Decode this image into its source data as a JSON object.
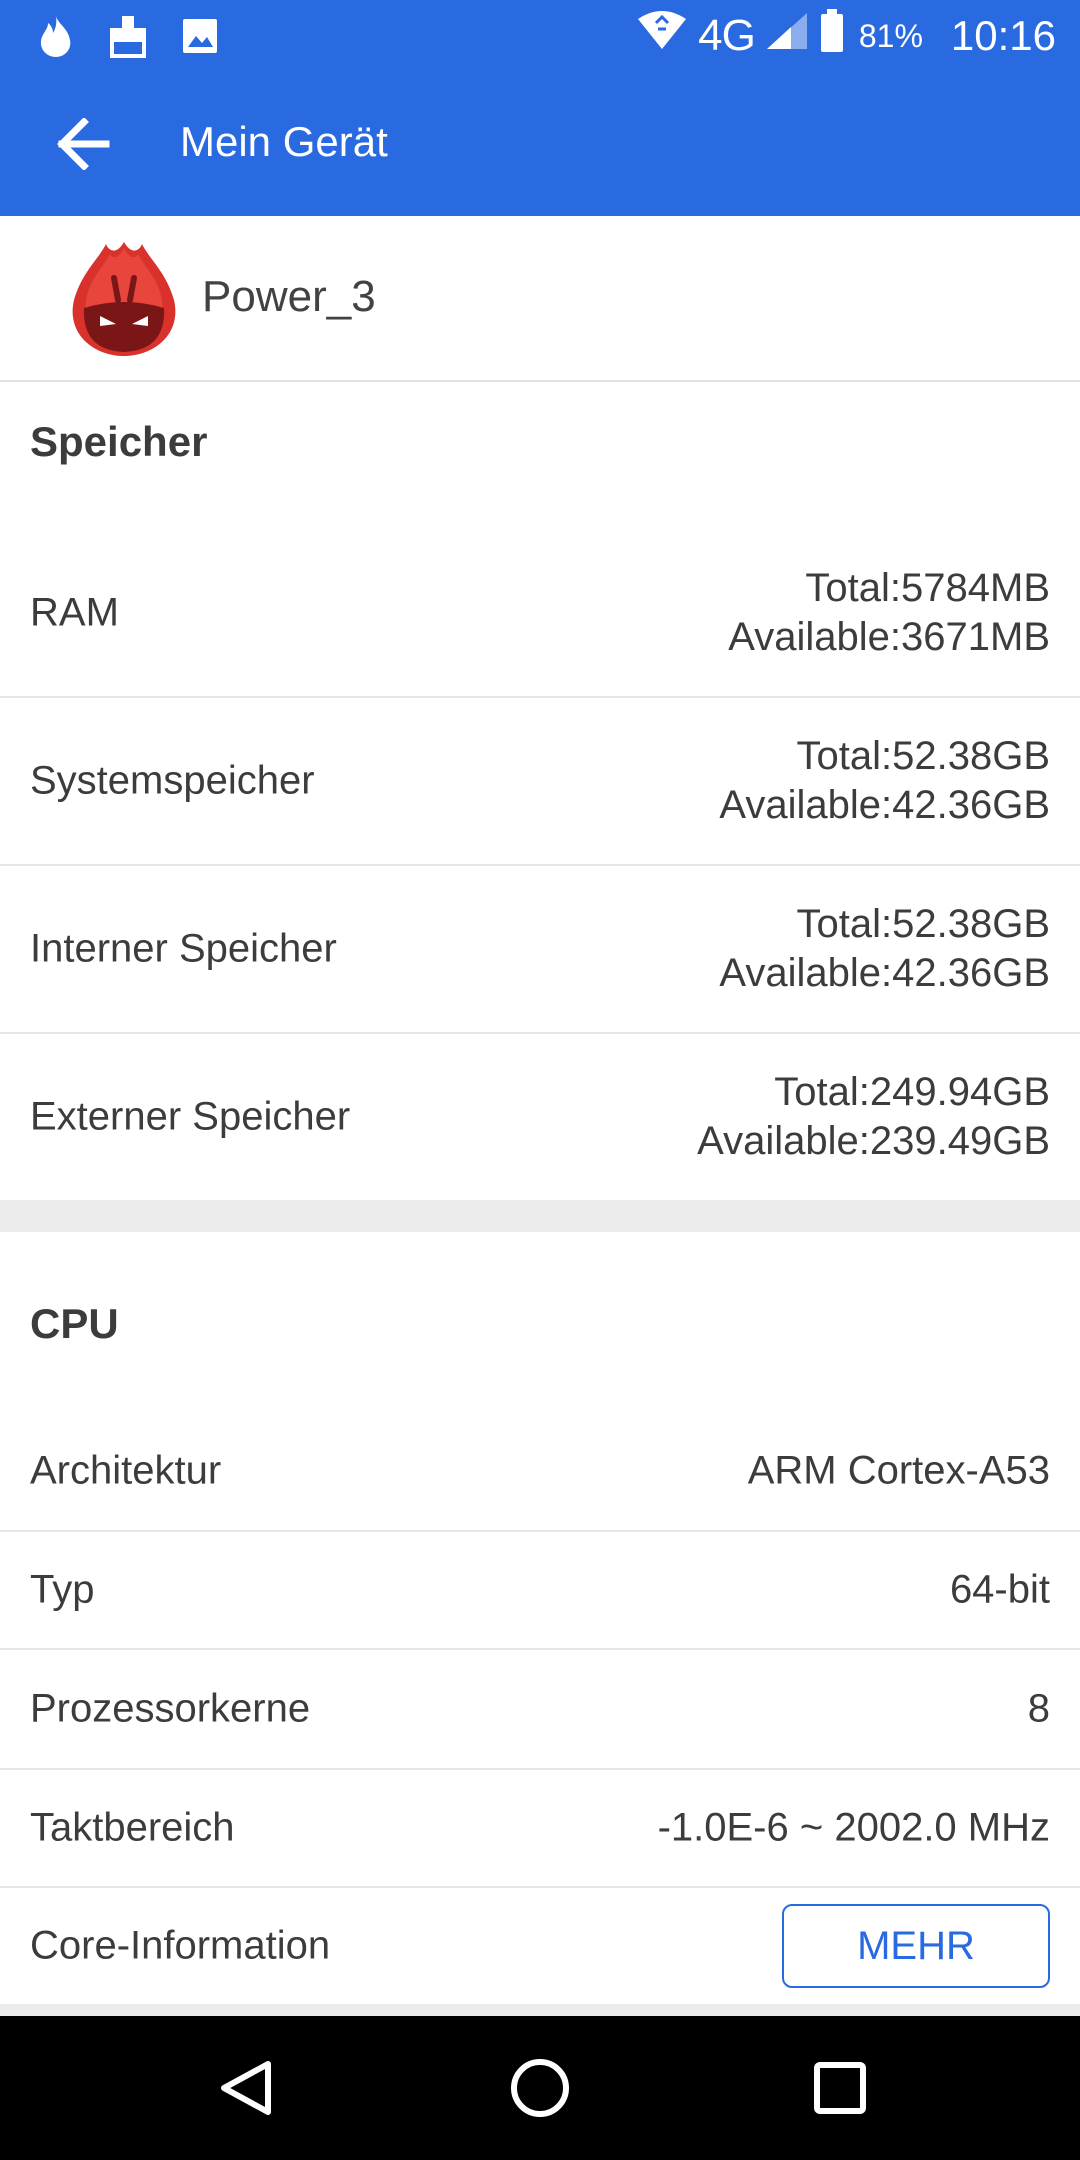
{
  "status_bar": {
    "left_icons": [
      "fire-notification-icon",
      "cleaner-notification-icon",
      "image-notification-icon"
    ],
    "network": "4G",
    "battery": "81%",
    "time": "10:16"
  },
  "app_bar": {
    "title": "Mein Gerät"
  },
  "device": {
    "name": "Power_3"
  },
  "memory": {
    "title": "Speicher",
    "rows": [
      {
        "label": "RAM",
        "total": "Total:5784MB",
        "available": "Available:3671MB"
      },
      {
        "label": "Systemspeicher",
        "total": "Total:52.38GB",
        "available": "Available:42.36GB"
      },
      {
        "label": "Interner Speicher",
        "total": "Total:52.38GB",
        "available": "Available:42.36GB"
      },
      {
        "label": "Externer Speicher",
        "total": "Total:249.94GB",
        "available": "Available:239.49GB"
      }
    ]
  },
  "cpu": {
    "title": "CPU",
    "rows": [
      {
        "label": "Architektur",
        "value": "ARM Cortex-A53"
      },
      {
        "label": "Typ",
        "value": "64-bit"
      },
      {
        "label": "Prozessorkerne",
        "value": "8"
      },
      {
        "label": "Taktbereich",
        "value": "-1.0E-6 ~ 2002.0 MHz"
      },
      {
        "label": "Core-Information",
        "button": "MEHR"
      }
    ]
  },
  "colors": {
    "accent": "#2a6ae0",
    "text": "#3c3c3c",
    "divider": "#e6e6e6"
  }
}
